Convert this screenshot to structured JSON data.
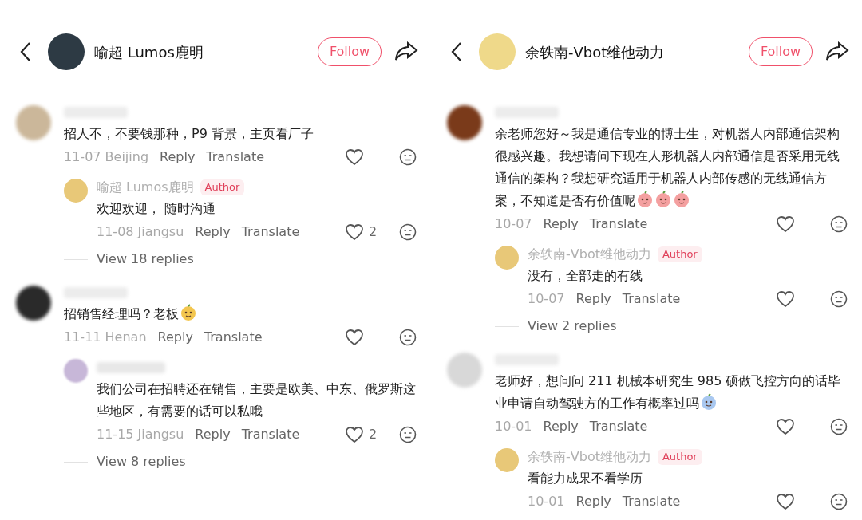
{
  "panels": [
    {
      "header": {
        "name": "喻超 Lumos鹿明",
        "follow": "Follow"
      },
      "comments": [
        {
          "text": "招人不，不要钱那种，P9 背景，主页看厂子",
          "date": "11-07",
          "location": "Beijing",
          "reply": "Reply",
          "translate": "Translate",
          "replies": [
            {
              "name": "喻超 Lumos鹿明",
              "badge": "Author",
              "text": "欢迎欢迎， 随时沟通",
              "date": "11-08",
              "location": "Jiangsu",
              "reply": "Reply",
              "translate": "Translate",
              "likes": "2"
            }
          ],
          "view_replies": "View 18 replies"
        },
        {
          "text": "招销售经理吗？老板",
          "stickers": [
            {
              "kind": "sprout"
            }
          ],
          "date": "11-11",
          "location": "Henan",
          "reply": "Reply",
          "translate": "Translate",
          "replies": [
            {
              "text": "我们公司在招聘还在销售，主要是欧美、中东、俄罗斯这些地区，有需要的话可以私哦",
              "date": "11-15",
              "location": "Jiangsu",
              "reply": "Reply",
              "translate": "Translate",
              "likes": "2"
            }
          ],
          "view_replies": "View 8 replies"
        }
      ]
    },
    {
      "header": {
        "name": "余轶南-Vbot维他动力",
        "follow": "Follow"
      },
      "comments": [
        {
          "text": "余老师您好～我是通信专业的博士生，对机器人内部通信架构很感兴趣。我想请问下现在人形机器人内部通信是否采用无线通信的架构？我想研究适用于机器人内部传感的无线通信方案，不知道是否有价值呢",
          "stickers": [
            {
              "kind": "pig"
            },
            {
              "kind": "pig"
            },
            {
              "kind": "pig"
            }
          ],
          "date": "10-07",
          "reply": "Reply",
          "translate": "Translate",
          "replies": [
            {
              "name": "余轶南-Vbot维他动力",
              "badge": "Author",
              "text": "没有，全部走的有线",
              "date": "10-07",
              "reply": "Reply",
              "translate": "Translate"
            }
          ],
          "view_replies": "View 2 replies"
        },
        {
          "text": "老师好，想问问 211 机械本研究生 985 硕做飞控方向的话毕业申请自动驾驶方的工作有概率过吗",
          "stickers": [
            {
              "kind": "crying"
            }
          ],
          "date": "10-01",
          "reply": "Reply",
          "translate": "Translate",
          "replies": [
            {
              "name": "余轶南-Vbot维他动力",
              "badge": "Author",
              "text": "看能力成果不看学历",
              "date": "10-01",
              "reply": "Reply",
              "translate": "Translate"
            }
          ]
        }
      ]
    }
  ]
}
